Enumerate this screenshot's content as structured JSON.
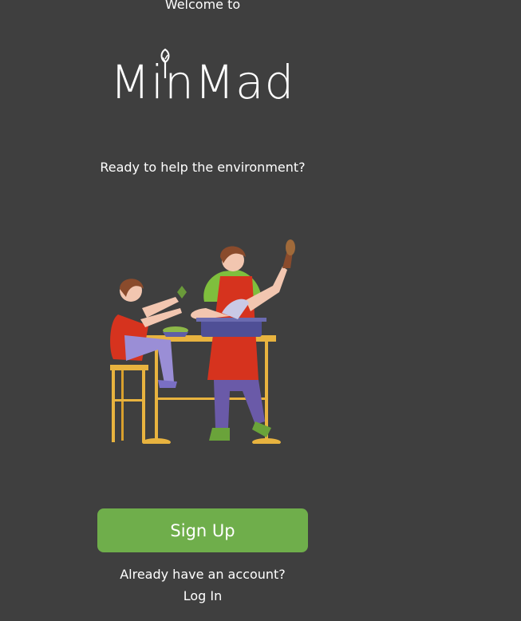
{
  "header": {
    "welcome_text": "Welcome to",
    "logo_text": "MinMad"
  },
  "main": {
    "tagline": "Ready to help the environment?",
    "illustration_icon": "cooking-couple-illustration"
  },
  "actions": {
    "signup_label": "Sign Up",
    "account_prompt": "Already have an account?",
    "login_label": "Log In"
  },
  "colors": {
    "background": "#3f3f3f",
    "accent": "#6fae4b"
  }
}
